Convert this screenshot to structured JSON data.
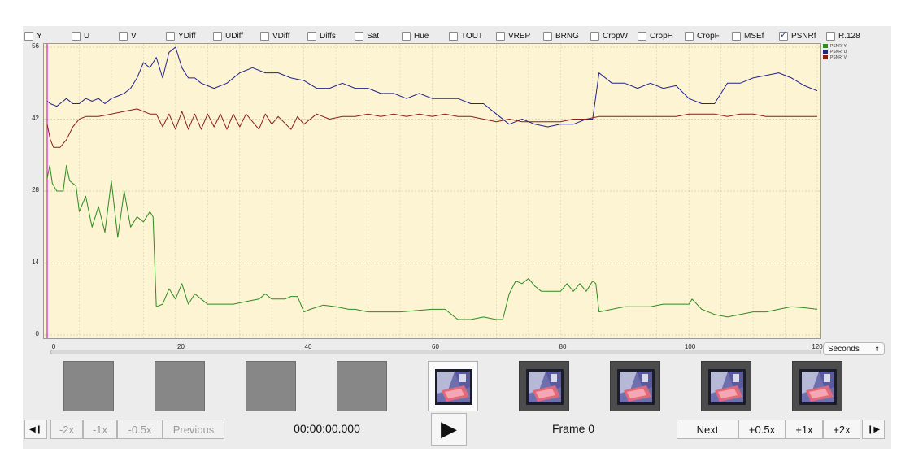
{
  "filters": [
    {
      "label": "Y",
      "checked": false
    },
    {
      "label": "U",
      "checked": false
    },
    {
      "label": "V",
      "checked": false
    },
    {
      "label": "YDiff",
      "checked": false
    },
    {
      "label": "UDiff",
      "checked": false
    },
    {
      "label": "VDiff",
      "checked": false
    },
    {
      "label": "Diffs",
      "checked": false
    },
    {
      "label": "Sat",
      "checked": false
    },
    {
      "label": "Hue",
      "checked": false
    },
    {
      "label": "TOUT",
      "checked": false
    },
    {
      "label": "VREP",
      "checked": false
    },
    {
      "label": "BRNG",
      "checked": false
    },
    {
      "label": "CropW",
      "checked": false
    },
    {
      "label": "CropH",
      "checked": false
    },
    {
      "label": "CropF",
      "checked": false
    },
    {
      "label": "MSEf",
      "checked": false
    },
    {
      "label": "PSNRf",
      "checked": true
    },
    {
      "label": "R.128",
      "checked": false
    }
  ],
  "chart_data": {
    "type": "line",
    "xlim": [
      0,
      120
    ],
    "ylim": [
      0,
      56
    ],
    "x_ticks": [
      "0",
      "20",
      "40",
      "60",
      "80",
      "100",
      "120"
    ],
    "y_ticks": [
      "0",
      "14",
      "28",
      "42",
      "56"
    ],
    "grid": true,
    "legend_position": "right",
    "series": [
      {
        "name": "PSNRf Y",
        "color": "#2e8b1f",
        "points": [
          [
            0,
            30.5
          ],
          [
            0.4,
            33
          ],
          [
            0.8,
            29.5
          ],
          [
            1.5,
            28
          ],
          [
            2.5,
            28
          ],
          [
            3,
            33
          ],
          [
            3.5,
            30
          ],
          [
            4.5,
            29
          ],
          [
            5,
            24
          ],
          [
            6,
            27
          ],
          [
            7,
            21
          ],
          [
            8,
            25
          ],
          [
            9,
            20
          ],
          [
            10,
            30
          ],
          [
            11,
            19
          ],
          [
            12,
            28
          ],
          [
            13,
            21
          ],
          [
            14,
            23
          ],
          [
            15,
            22
          ],
          [
            16,
            24
          ],
          [
            16.5,
            23
          ],
          [
            17,
            5.5
          ],
          [
            18,
            6
          ],
          [
            19,
            9
          ],
          [
            20,
            7
          ],
          [
            21,
            10
          ],
          [
            22,
            6
          ],
          [
            23,
            8
          ],
          [
            24,
            7
          ],
          [
            25,
            6
          ],
          [
            27,
            6
          ],
          [
            29,
            6
          ],
          [
            31,
            6.5
          ],
          [
            33,
            7
          ],
          [
            34,
            8
          ],
          [
            35,
            7
          ],
          [
            37,
            7
          ],
          [
            38,
            7.5
          ],
          [
            39,
            7.5
          ],
          [
            40,
            4.5
          ],
          [
            41,
            5
          ],
          [
            43,
            5.8
          ],
          [
            45,
            5.5
          ],
          [
            47,
            5
          ],
          [
            48,
            5
          ],
          [
            50,
            4.5
          ],
          [
            55,
            4.5
          ],
          [
            60,
            5
          ],
          [
            62,
            5
          ],
          [
            64,
            3
          ],
          [
            66,
            3
          ],
          [
            68,
            3.5
          ],
          [
            70,
            3
          ],
          [
            71,
            3
          ],
          [
            72,
            8
          ],
          [
            73,
            10.5
          ],
          [
            74,
            10
          ],
          [
            75,
            11
          ],
          [
            76,
            9.5
          ],
          [
            77,
            8.5
          ],
          [
            79,
            8.5
          ],
          [
            80,
            8.5
          ],
          [
            81,
            10
          ],
          [
            82,
            8.5
          ],
          [
            83,
            10
          ],
          [
            84,
            8.5
          ],
          [
            85,
            10.5
          ],
          [
            85.5,
            10
          ],
          [
            86,
            4.5
          ],
          [
            88,
            5
          ],
          [
            90,
            5.5
          ],
          [
            92,
            5.5
          ],
          [
            94,
            5.5
          ],
          [
            96,
            6
          ],
          [
            98,
            6
          ],
          [
            100,
            6
          ],
          [
            100.5,
            7
          ],
          [
            102,
            5
          ],
          [
            104,
            4
          ],
          [
            106,
            3.5
          ],
          [
            108,
            4
          ],
          [
            110,
            4.5
          ],
          [
            112,
            4.5
          ],
          [
            114,
            5
          ],
          [
            116,
            5.5
          ],
          [
            118,
            5.3
          ],
          [
            120,
            5
          ]
        ]
      },
      {
        "name": "PSNRf U",
        "color": "#23238c",
        "points": [
          [
            0,
            45.5
          ],
          [
            0.5,
            45
          ],
          [
            1.5,
            44.5
          ],
          [
            3,
            46
          ],
          [
            4,
            45
          ],
          [
            5,
            45
          ],
          [
            6,
            46
          ],
          [
            7,
            45.5
          ],
          [
            8,
            46
          ],
          [
            9,
            45
          ],
          [
            10,
            46
          ],
          [
            11,
            46.5
          ],
          [
            12,
            47
          ],
          [
            13,
            48
          ],
          [
            14,
            50
          ],
          [
            15,
            53
          ],
          [
            16,
            52
          ],
          [
            17,
            54
          ],
          [
            18,
            50
          ],
          [
            19,
            55
          ],
          [
            20,
            56
          ],
          [
            21,
            52
          ],
          [
            22,
            50
          ],
          [
            23,
            50
          ],
          [
            24,
            49
          ],
          [
            26,
            48
          ],
          [
            28,
            49
          ],
          [
            30,
            51
          ],
          [
            32,
            52
          ],
          [
            34,
            51
          ],
          [
            36,
            51
          ],
          [
            38,
            50
          ],
          [
            40,
            49.5
          ],
          [
            42,
            48
          ],
          [
            44,
            48
          ],
          [
            46,
            49
          ],
          [
            48,
            48
          ],
          [
            50,
            48
          ],
          [
            52,
            47
          ],
          [
            54,
            47
          ],
          [
            56,
            46
          ],
          [
            58,
            47
          ],
          [
            60,
            46
          ],
          [
            62,
            46
          ],
          [
            64,
            46
          ],
          [
            66,
            45
          ],
          [
            68,
            45
          ],
          [
            70,
            43
          ],
          [
            72,
            41
          ],
          [
            74,
            42
          ],
          [
            76,
            41
          ],
          [
            78,
            40.5
          ],
          [
            80,
            41
          ],
          [
            82,
            41
          ],
          [
            84,
            42
          ],
          [
            85,
            42
          ],
          [
            86,
            51
          ],
          [
            88,
            49
          ],
          [
            90,
            49
          ],
          [
            92,
            48
          ],
          [
            94,
            49
          ],
          [
            96,
            48
          ],
          [
            98,
            48.5
          ],
          [
            100,
            46
          ],
          [
            102,
            45
          ],
          [
            104,
            45
          ],
          [
            106,
            49
          ],
          [
            108,
            49
          ],
          [
            110,
            50
          ],
          [
            112,
            50.5
          ],
          [
            114,
            51
          ],
          [
            116,
            50
          ],
          [
            118,
            48.5
          ],
          [
            120,
            47.5
          ]
        ]
      },
      {
        "name": "PSNRf V",
        "color": "#8a1f1a",
        "points": [
          [
            0,
            41
          ],
          [
            0.5,
            38
          ],
          [
            1,
            36.5
          ],
          [
            2,
            36.5
          ],
          [
            3,
            38
          ],
          [
            4,
            40.5
          ],
          [
            5,
            42
          ],
          [
            6,
            42.5
          ],
          [
            8,
            42.5
          ],
          [
            10,
            43
          ],
          [
            12,
            43.5
          ],
          [
            14,
            44
          ],
          [
            16,
            43
          ],
          [
            17,
            43
          ],
          [
            18,
            40.5
          ],
          [
            19,
            43
          ],
          [
            20,
            40
          ],
          [
            21,
            43.5
          ],
          [
            22,
            40
          ],
          [
            23,
            43
          ],
          [
            24,
            40
          ],
          [
            25,
            43
          ],
          [
            26,
            40.5
          ],
          [
            27,
            43
          ],
          [
            28,
            40
          ],
          [
            29,
            43
          ],
          [
            30,
            40.5
          ],
          [
            31,
            43
          ],
          [
            33,
            40
          ],
          [
            34,
            43
          ],
          [
            35,
            41
          ],
          [
            36,
            42.5
          ],
          [
            38,
            40
          ],
          [
            39,
            42.5
          ],
          [
            40,
            41
          ],
          [
            42,
            43
          ],
          [
            44,
            42
          ],
          [
            46,
            42.5
          ],
          [
            48,
            42.5
          ],
          [
            50,
            43
          ],
          [
            52,
            42.5
          ],
          [
            54,
            43
          ],
          [
            56,
            42.5
          ],
          [
            58,
            43
          ],
          [
            60,
            42.5
          ],
          [
            62,
            43
          ],
          [
            64,
            42.5
          ],
          [
            66,
            42.5
          ],
          [
            68,
            42
          ],
          [
            70,
            41.5
          ],
          [
            72,
            42
          ],
          [
            74,
            41.5
          ],
          [
            76,
            41.5
          ],
          [
            78,
            41.5
          ],
          [
            80,
            41.5
          ],
          [
            82,
            42
          ],
          [
            84,
            42
          ],
          [
            86,
            42.5
          ],
          [
            88,
            42.5
          ],
          [
            90,
            42.5
          ],
          [
            92,
            42.5
          ],
          [
            94,
            42.5
          ],
          [
            96,
            42.5
          ],
          [
            98,
            42.5
          ],
          [
            100,
            43
          ],
          [
            102,
            43
          ],
          [
            104,
            43
          ],
          [
            106,
            42.5
          ],
          [
            108,
            43
          ],
          [
            110,
            43
          ],
          [
            112,
            42.5
          ],
          [
            114,
            42.5
          ],
          [
            116,
            42.5
          ],
          [
            118,
            42.5
          ],
          [
            120,
            42.5
          ]
        ]
      }
    ]
  },
  "legend_entries": [
    "PSNRf Y",
    "PSNRf U",
    "PSNRf V"
  ],
  "unit_select": {
    "value": "Seconds",
    "arrow": "⇕"
  },
  "thumbnails": [
    "empty",
    "empty",
    "empty",
    "empty",
    "current",
    "frame",
    "frame",
    "frame",
    "frame"
  ],
  "controls": {
    "prev_frame_icon": "◀❙",
    "next_frame_icon": "❙▶",
    "minus_2x": "-2x",
    "minus_1x": "-1x",
    "minus_05x": "-0.5x",
    "previous": "Previous",
    "timecode": "00:00:00.000",
    "play_icon": "▶",
    "frame_label": "Frame 0",
    "next": "Next",
    "plus_05x": "+0.5x",
    "plus_1x": "+1x",
    "plus_2x": "+2x"
  }
}
